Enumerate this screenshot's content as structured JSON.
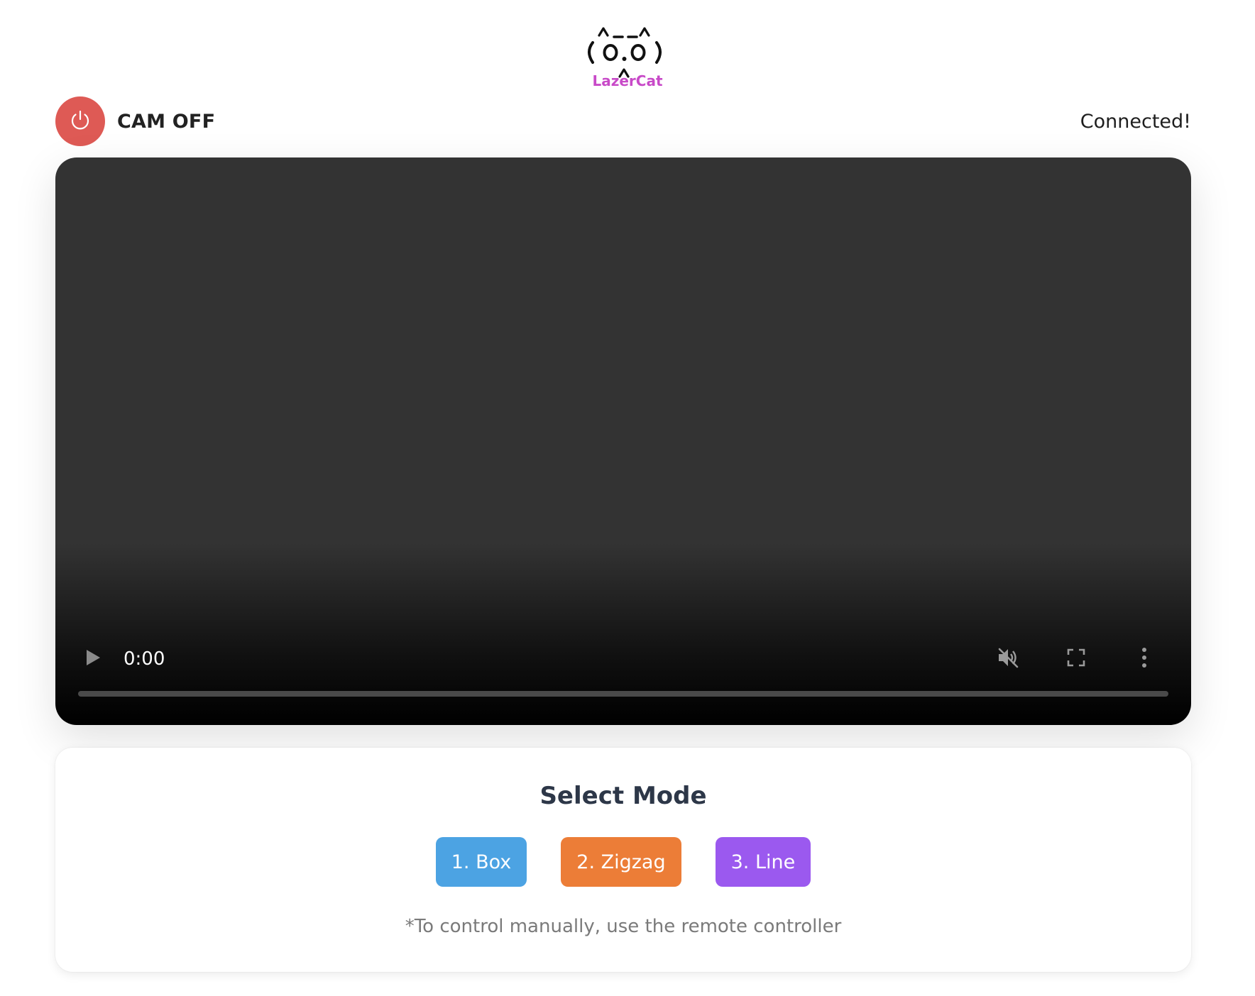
{
  "logo": {
    "art_icon": "cat-face-ascii-icon",
    "name": "LazerCat",
    "name_color": "#c84ac8"
  },
  "camera": {
    "label": "CAM OFF",
    "icon": "power-icon",
    "button_color": "#de5a55"
  },
  "connection": {
    "status": "Connected!"
  },
  "video": {
    "time": "0:00",
    "controls": [
      "play-icon",
      "muted-icon",
      "fullscreen-icon",
      "more-vert-icon"
    ],
    "progress": 0
  },
  "mode": {
    "title": "Select Mode",
    "buttons": [
      {
        "label": "1. Box",
        "color": "#4ca3e3"
      },
      {
        "label": "2. Zigzag",
        "color": "#ec7d37"
      },
      {
        "label": "3. Line",
        "color": "#9b59ef"
      }
    ],
    "note": "*To control manually, use the remote controller"
  }
}
